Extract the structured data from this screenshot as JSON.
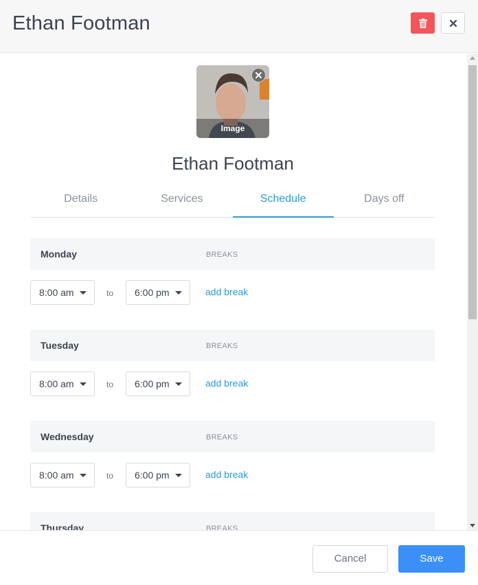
{
  "header": {
    "title": "Ethan Footman"
  },
  "profile": {
    "name": "Ethan Footman",
    "avatar_label": "Image",
    "remove_icon": "×"
  },
  "tabs": [
    {
      "label": "Details",
      "active": false
    },
    {
      "label": "Services",
      "active": false
    },
    {
      "label": "Schedule",
      "active": true
    },
    {
      "label": "Days off",
      "active": false
    }
  ],
  "schedule": {
    "days": [
      {
        "name": "Monday",
        "breaks_label": "BREAKS",
        "start": "8:00 am",
        "to_label": "to",
        "end": "6:00 pm",
        "add_break": "add break"
      },
      {
        "name": "Tuesday",
        "breaks_label": "BREAKS",
        "start": "8:00 am",
        "to_label": "to",
        "end": "6:00 pm",
        "add_break": "add break"
      },
      {
        "name": "Wednesday",
        "breaks_label": "BREAKS",
        "start": "8:00 am",
        "to_label": "to",
        "end": "6:00 pm",
        "add_break": "add break"
      },
      {
        "name": "Thursday",
        "breaks_label": "BREAKS"
      }
    ]
  },
  "footer": {
    "cancel_label": "Cancel",
    "save_label": "Save"
  },
  "colors": {
    "accent": "#2b9bd0",
    "save": "#3b8ff6",
    "delete": "#f4555b"
  },
  "icons": {
    "delete": "trash-icon",
    "close": "close-icon"
  }
}
